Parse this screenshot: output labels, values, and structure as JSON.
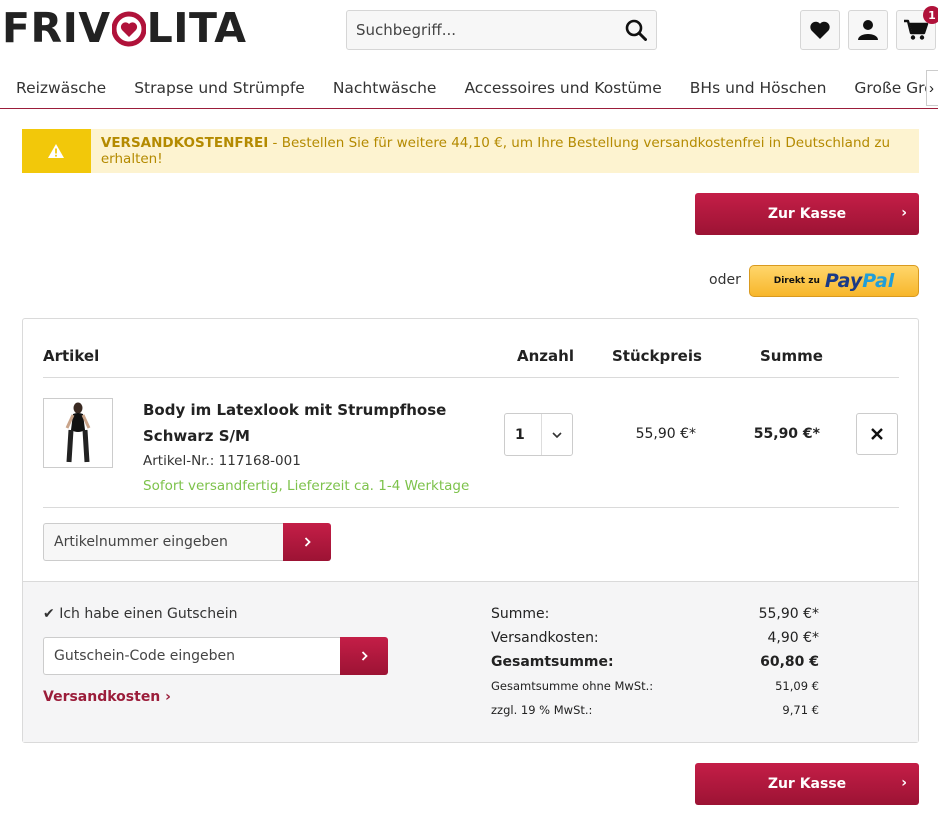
{
  "header": {
    "logo_part1": "FRIV",
    "logo_part2": "LITA",
    "search_placeholder": "Suchbegriff...",
    "cart_count": "1",
    "brand_color": "#b0123a"
  },
  "nav": {
    "items": [
      "Reizwäsche",
      "Strapse und Strümpfe",
      "Nachtwäsche",
      "Accessoires und Kostüme",
      "BHs und Höschen",
      "Große Größe"
    ]
  },
  "alert": {
    "strong": "VERSANDKOSTENFREI",
    "text": " - Bestellen Sie für weitere 44,10 €, um Ihre Bestellung versandkostenfrei in Deutschland zu erhalten!"
  },
  "checkout": {
    "label": "Zur Kasse",
    "or_label": "oder",
    "paypal_prefix": "Direkt zu",
    "paypal_a": "Pay",
    "paypal_b": "Pal"
  },
  "cart": {
    "headers": {
      "article": "Artikel",
      "quantity": "Anzahl",
      "unit_price": "Stückpreis",
      "total": "Summe"
    },
    "items": [
      {
        "name": "Body im Latexlook mit Strumpfhose Schwarz S/M",
        "article_no": "Artikel-Nr.: 117168-001",
        "stock": "Sofort versandfertig, Lieferzeit ca. 1-4 Werktage",
        "quantity": "1",
        "unit_price": "55,90 €*",
        "total": "55,90 €*"
      }
    ],
    "article_input_placeholder": "Artikelnummer eingeben"
  },
  "summary": {
    "voucher_label": "Ich habe einen Gutschein",
    "voucher_placeholder": "Gutschein-Code eingeben",
    "shipping_link": "Versandkosten",
    "rows": [
      {
        "label": "Summe:",
        "value": "55,90 €*"
      },
      {
        "label": "Versandkosten:",
        "value": "4,90 €*"
      },
      {
        "label": "Gesamtsumme:",
        "value": "60,80 €"
      },
      {
        "label": "Gesamtsumme ohne MwSt.:",
        "value": "51,09 €"
      },
      {
        "label": "zzgl. 19 % MwSt.:",
        "value": "9,71 €"
      }
    ]
  }
}
